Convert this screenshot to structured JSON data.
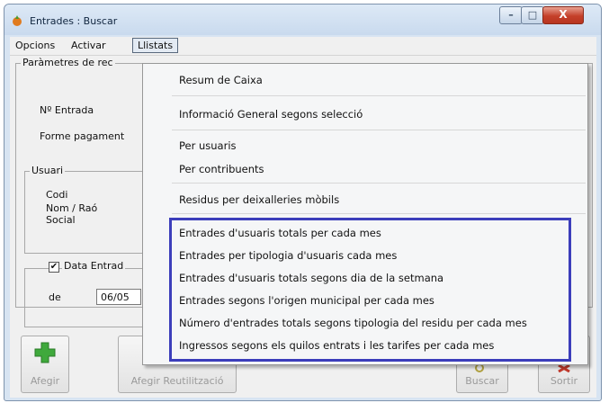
{
  "window": {
    "title": "Entrades : Buscar",
    "min_glyph": "–",
    "max_glyph": "□",
    "close_glyph": "X"
  },
  "menubar": {
    "items": [
      "Opcions",
      "Activar",
      "Llistats"
    ]
  },
  "form": {
    "params_legend": "Paràmetres de rec",
    "entrada_label": "Nº Entrada",
    "forma_pagament_label": "Forme pagament",
    "usuari_legend": "Usuari",
    "codi_label": "Codi",
    "nom_label_1": "Nom / Raó",
    "nom_label_2": "Social",
    "data_check": "✔",
    "data_label": "Data Entrad",
    "de_label": "de",
    "date_value": "06/05"
  },
  "buttons": {
    "afegir": "Afegir",
    "afegir_reutilitzacio": "Afegir Reutilització",
    "buscar": "Buscar",
    "sortir": "Sortir"
  },
  "dropdown": {
    "items": [
      "Resum de Caixa",
      "Informació General segons selecció",
      "Per usuaris",
      "Per contribuents",
      "Residus per deixalleries mòbils",
      "Entrades d'usuaris totals per cada mes",
      "Entrades per tipologia d'usuaris cada mes",
      "Entrades d'usuaris totals segons dia de la setmana",
      "Entrades segons l'origen municipal per cada mes",
      "Número d'entrades totals segons tipologia del residu per cada mes",
      "Ingressos segons els quilos entrats i les tarifes per cada mes"
    ]
  },
  "colors": {
    "highlight_border": "#3c3ebb",
    "close_button": "#c4402a",
    "add_icon": "#3fa93c"
  }
}
